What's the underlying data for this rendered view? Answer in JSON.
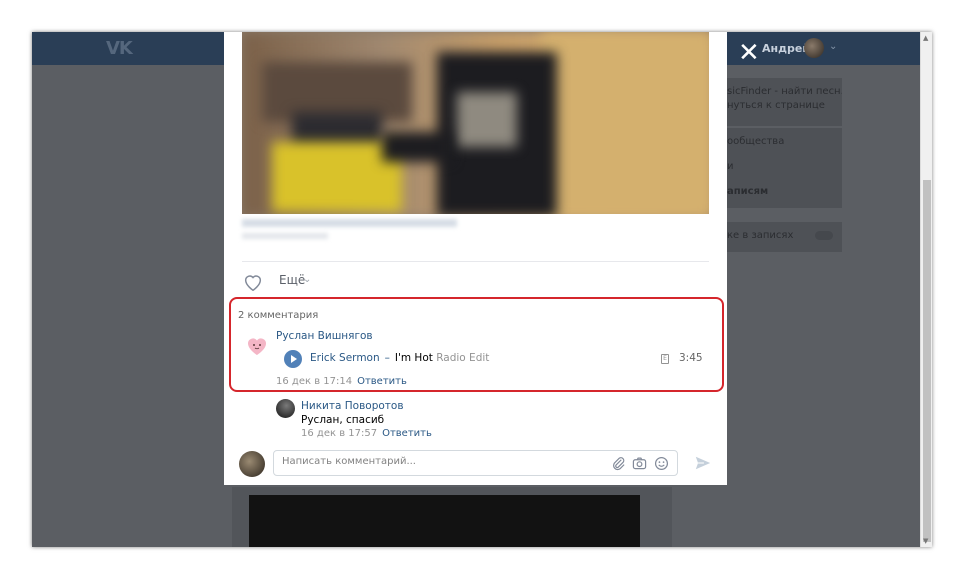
{
  "topbar": {
    "logo": "VK",
    "user_name": "Андрей",
    "close_symbol": "✕"
  },
  "right_panel": {
    "app_line1": "sicFinder - найти песн...",
    "app_line2": "нуться к странице",
    "communities": "ообщества",
    "news": "и",
    "posts": "аписям",
    "posts_toggle_label": "ке в записях"
  },
  "post": {
    "more_label": "Ещё"
  },
  "comments": {
    "count_label": "2 комментария",
    "items": [
      {
        "author": "Руслан Вишнягов",
        "audio": {
          "artist": "Erick Sermon",
          "dash": "–",
          "title": "I'm Hot",
          "subtitle": "Radio Edit",
          "duration": "3:45"
        },
        "date": "16 дек в 17:14",
        "reply_label": "Ответить"
      },
      {
        "author": "Никита Поворотов",
        "text": "Руслан, спасиб",
        "date": "16 дек в 17:57",
        "reply_label": "Ответить"
      }
    ],
    "input_placeholder": "Написать комментарий..."
  },
  "colors": {
    "link": "#2a5885",
    "header": "#2a3e56",
    "accent": "#5181b8",
    "highlight": "#d5262c"
  }
}
